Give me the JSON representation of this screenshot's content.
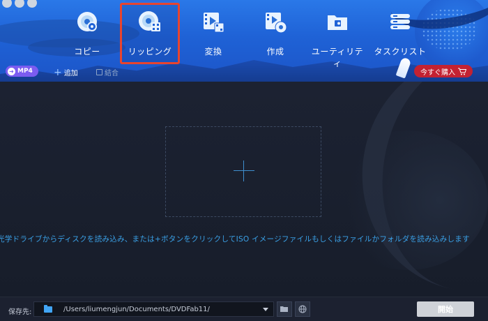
{
  "window": {
    "traffic_lights": [
      "close",
      "minimize",
      "zoom"
    ]
  },
  "nav": {
    "selected": "ripping",
    "items": [
      {
        "id": "copy",
        "label": "コピー",
        "icon": "disc-copy-icon"
      },
      {
        "id": "ripping",
        "label": "リッピング",
        "icon": "disc-ripping-icon"
      },
      {
        "id": "convert",
        "label": "変換",
        "icon": "video-convert-icon"
      },
      {
        "id": "create",
        "label": "作成",
        "icon": "disc-create-icon"
      },
      {
        "id": "utility",
        "label": "ユーティリティ",
        "icon": "toolbox-icon"
      },
      {
        "id": "tasks",
        "label": "タスクリスト",
        "icon": "task-list-icon"
      }
    ]
  },
  "toolbar": {
    "format_label": "MP4",
    "add_label": "追加",
    "merge_label": "結合",
    "buy_label": "今すぐ購入"
  },
  "main": {
    "hint": "光学ドライブからディスクを読み込み、または+ボタンをクリックしてISO イメージファイルもしくはファイルかフォルダを読み込みします"
  },
  "footer": {
    "save_label": "保存先:",
    "path_value": "/Users/liumengjun/Documents/DVDFab11/",
    "start_label": "開始"
  },
  "colors": {
    "header_blue": "#1f62d6",
    "selection_red": "#e8442e",
    "format_purple": "#7b5cf0",
    "buy_red": "#c32232",
    "hint_blue": "#3aa0e6"
  }
}
